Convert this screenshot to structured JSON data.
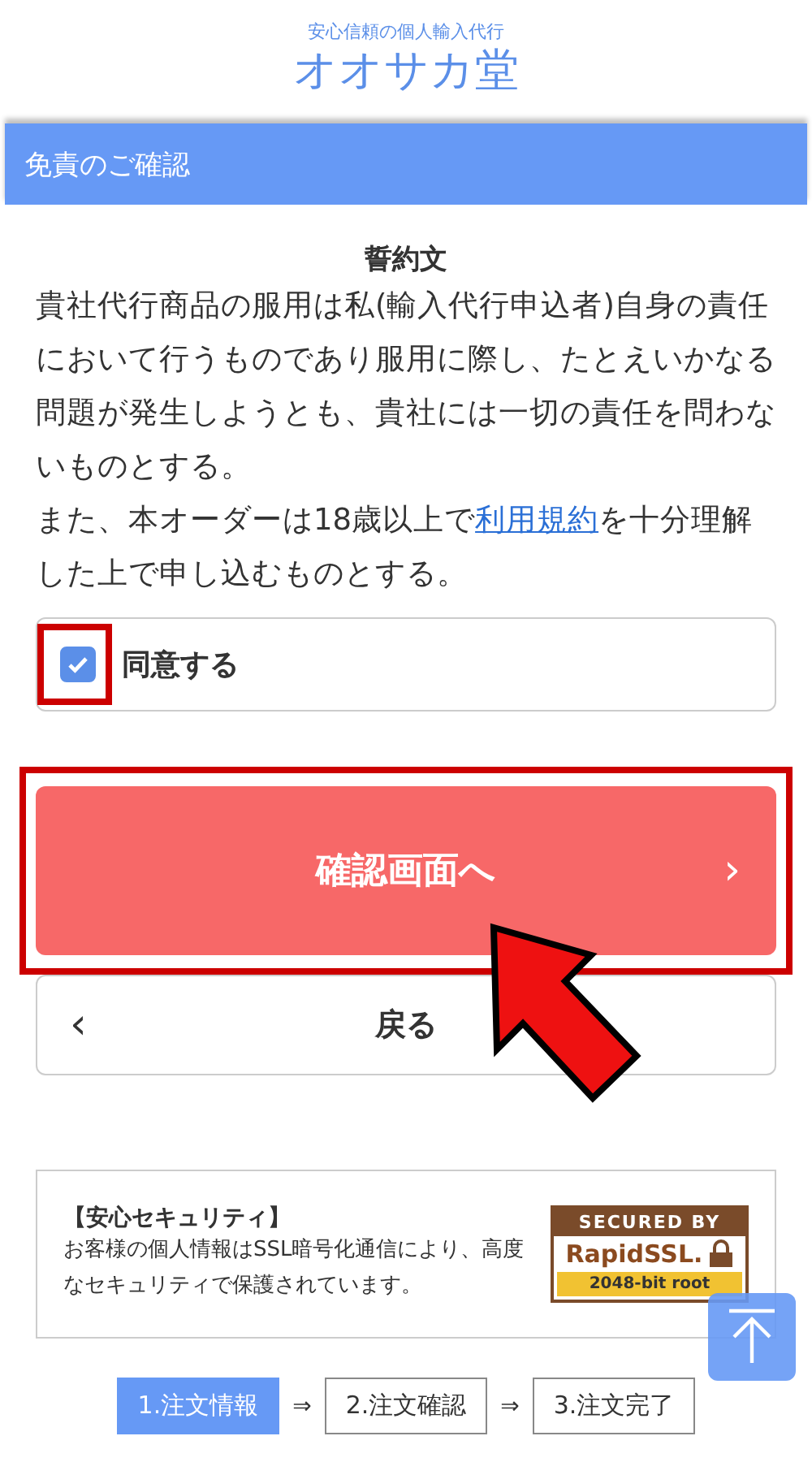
{
  "header": {
    "tagline": "安心信頼の個人輸入代行",
    "logo": "オオサカ堂"
  },
  "section": {
    "title": "免責のご確認"
  },
  "pledge": {
    "title": "誓約文",
    "paragraph_1": "貴社代行商品の服用は私(輸入代行申込者)自身の責任において行うものであり服用に際し、たとえいかなる問題が発生しようとも、貴社には一切の責任を問わないものとする。",
    "paragraph_2_before": "また、本オーダーは18歳以上で",
    "paragraph_2_link": "利用規約",
    "paragraph_2_after": "を十分理解した上で申し込むものとする。"
  },
  "agree": {
    "label": "同意する",
    "checked": true
  },
  "buttons": {
    "confirm": {
      "label": "確認画面へ",
      "arrow": "›"
    },
    "back": {
      "label": "戻る",
      "arrow": "‹"
    }
  },
  "security": {
    "title": "【安心セキュリティ】",
    "text": "お客様の個人情報はSSL暗号化通信により、高度なセキュリティで保護されています。",
    "badge": {
      "top": "SECURED BY",
      "brand": "RapidSSL.",
      "bottom": "2048-bit root"
    }
  },
  "steps": [
    {
      "label": "1.注文情報",
      "selected": true
    },
    {
      "label": "2.注文確認",
      "selected": false
    },
    {
      "label": "3.注文完了",
      "selected": false
    }
  ],
  "step_separator": "⇒"
}
